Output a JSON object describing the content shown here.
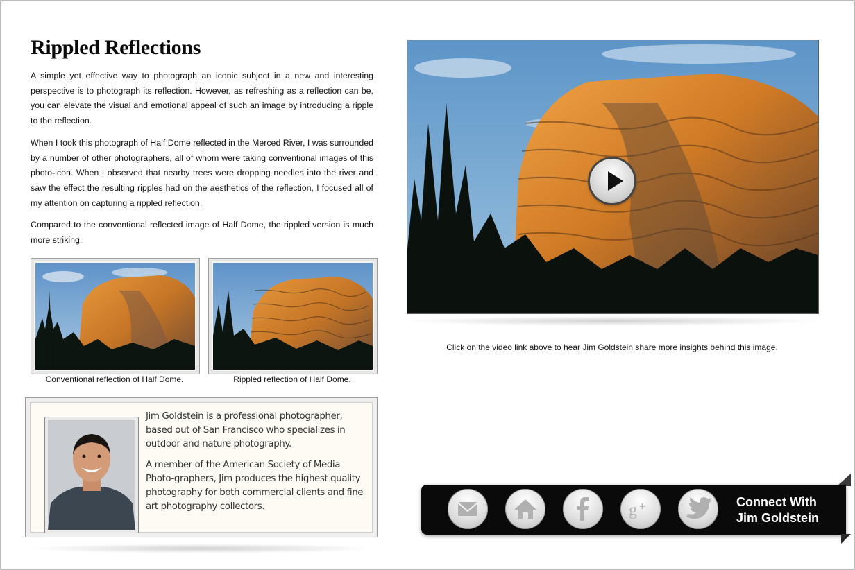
{
  "article": {
    "title": "Rippled Reflections",
    "paragraphs": [
      "A simple yet effective way to photograph an iconic subject in a new and interesting perspective is to photograph its reflection. However, as refreshing as a reflection can be, you can elevate the visual and emotional appeal of such an image by introducing a ripple to the reflection.",
      "When I took this photograph of Half Dome reflected in the Merced River, I was surrounded by a number of other photographers, all of whom were taking conventional images of this photo-icon. When I observed that nearby trees were dropping needles into the river and saw the effect the resulting ripples had on the aesthetics of the reflection, I focused all of my attention on capturing a rippled reflection.",
      "Compared to the conventional reflected image of Half Dome, the rippled version is much more striking."
    ]
  },
  "thumbnails": [
    {
      "caption": "Conventional reflection of Half Dome."
    },
    {
      "caption": "Rippled reflection of Half Dome."
    }
  ],
  "bio": {
    "paragraphs": [
      "Jim Goldstein is a professional photographer, based out of San Francisco who specializes in outdoor and nature photography.",
      "A member of the American Society of Media Photo-graphers, Jim produces the highest quality photography for both commercial clients and fine art photography collectors."
    ]
  },
  "video": {
    "caption": "Click on the video link above to hear Jim Goldstein share more insights behind this image.",
    "play_icon": "play-icon"
  },
  "social": {
    "icons": [
      "mail-icon",
      "home-icon",
      "facebook-icon",
      "google-plus-icon",
      "twitter-icon"
    ],
    "connect_line1": "Connect With",
    "connect_line2": "Jim Goldstein"
  },
  "colors": {
    "sky": "#6a9ccc",
    "dome_orange": "#d4822a",
    "bar_bg": "#0a0a0a",
    "bio_bg": "#fdfbf3"
  }
}
